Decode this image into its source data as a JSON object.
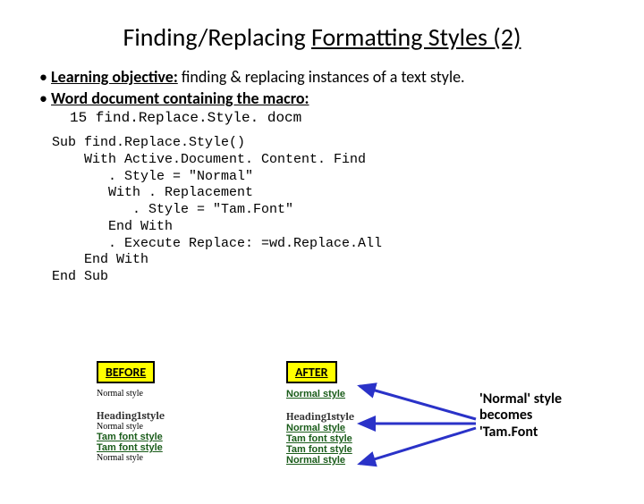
{
  "title": {
    "plain": "Finding/Replacing ",
    "underlined": "Formatting Styles (2)"
  },
  "bullets": [
    {
      "bold": "Learning objective:",
      "rest": " finding & replacing instances of a text style."
    },
    {
      "bold": "Word document containing the macro:",
      "rest": ""
    }
  ],
  "filename": "15 find.Replace.Style. docm",
  "code": "Sub find.Replace.Style()\n    With Active.Document. Content. Find\n       . Style = \"Normal\"\n       With . Replacement\n          . Style = \"Tam.Font\"\n       End With\n       . Execute Replace: =wd.Replace.All\n    End With\nEnd Sub",
  "before": {
    "label": "BEFORE",
    "lines": [
      {
        "text": "Normal style",
        "cls": "serif small"
      },
      {
        "text": "",
        "cls": ""
      },
      {
        "text": "Heading1style",
        "cls": "h1"
      },
      {
        "text": "Normal style",
        "cls": "serif small"
      },
      {
        "text": "Tam font style",
        "cls": "tam"
      },
      {
        "text": "Tam font style",
        "cls": "tam"
      },
      {
        "text": "Normal style",
        "cls": "serif small"
      }
    ]
  },
  "after": {
    "label": "AFTER",
    "lines": [
      {
        "text": "Normal style",
        "cls": "tam"
      },
      {
        "text": "",
        "cls": ""
      },
      {
        "text": "Heading1style",
        "cls": "h1"
      },
      {
        "text": "Normal style",
        "cls": "tam"
      },
      {
        "text": "Tam font style",
        "cls": "tam"
      },
      {
        "text": "Tam font style",
        "cls": "tam"
      },
      {
        "text": "Normal style",
        "cls": "tam"
      }
    ]
  },
  "annotation": "'Normal' style becomes 'Tam.Font"
}
